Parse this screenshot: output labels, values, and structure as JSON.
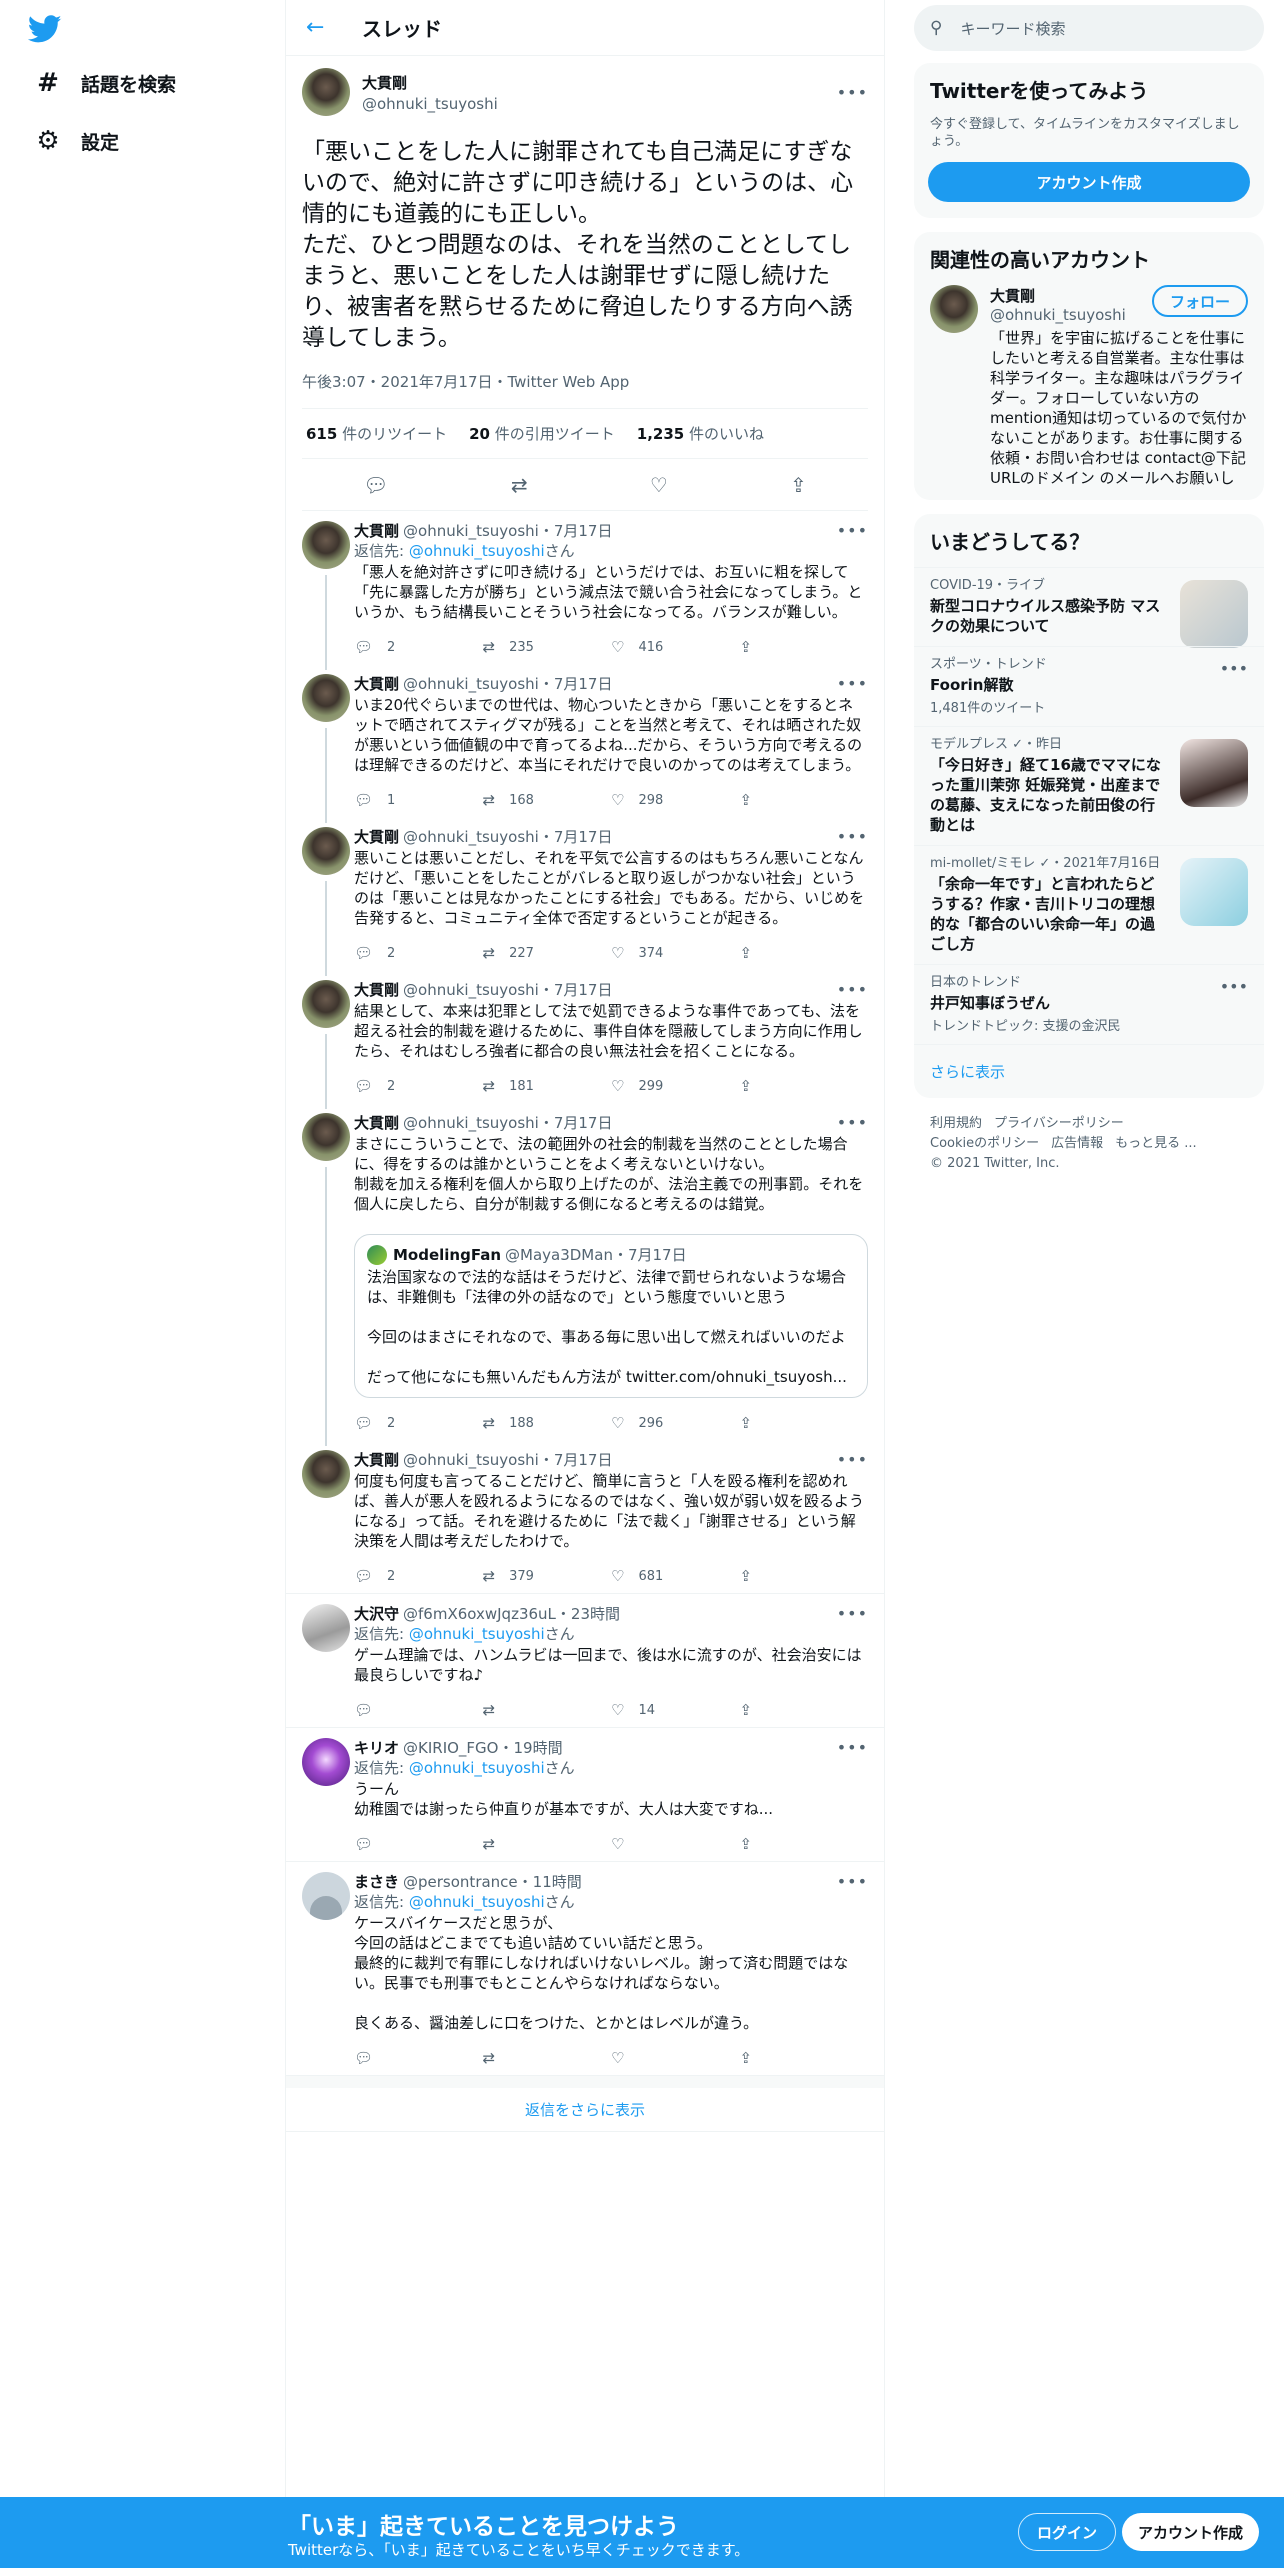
{
  "nav": {
    "explore": "話題を検索",
    "settings": "設定"
  },
  "header": {
    "title": "スレッド"
  },
  "focus": {
    "name": "大貫剛",
    "handle": "@ohnuki_tsuyoshi",
    "text": "「悪いことをした人に謝罪されても自己満足にすぎないので、絶対に許さずに叩き続ける」というのは、心情的にも道義的にも正しい。\nただ、ひとつ問題なのは、それを当然のこととしてしまうと、悪いことをした人は謝罪せずに隠し続けたり、被害者を黙らせるために脅迫したりする方向へ誘導してしまう。",
    "meta": "午後3:07・2021年7月17日・Twitter Web App",
    "retweets_num": "615",
    "retweets_label": "件のリツイート",
    "quotes_num": "20",
    "quotes_label": "件の引用ツイート",
    "likes_num": "1,235",
    "likes_label": "件のいいね"
  },
  "replies": [
    {
      "name": "大貫剛",
      "handle": "@ohnuki_tsuyoshi・7月17日",
      "to_prefix": "返信先: ",
      "to": "@ohnuki_tsuyoshi",
      "to_suffix": "さん",
      "text": "「悪人を絶対許さずに叩き続ける」というだけでは、お互いに粗を探して「先に暴露した方が勝ち」という減点法で競い合う社会になってしまう。というか、もう結構長いことそういう社会になってる。バランスが難しい。",
      "replies": "2",
      "retweets": "235",
      "likes": "416"
    },
    {
      "name": "大貫剛",
      "handle": "@ohnuki_tsuyoshi・7月17日",
      "text": "いま20代ぐらいまでの世代は、物心ついたときから「悪いことをするとネットで晒されてスティグマが残る」ことを当然と考えて、それは晒された奴が悪いという価値観の中で育ってるよね...だから、そういう方向で考えるのは理解できるのだけど、本当にそれだけで良いのかってのは考えてしまう。",
      "replies": "1",
      "retweets": "168",
      "likes": "298"
    },
    {
      "name": "大貫剛",
      "handle": "@ohnuki_tsuyoshi・7月17日",
      "text": "悪いことは悪いことだし、それを平気で公言するのはもちろん悪いことなんだけど、「悪いことをしたことがバレると取り返しがつかない社会」というのは「悪いことは見なかったことにする社会」でもある。だから、いじめを告発すると、コミュニティ全体で否定するということが起きる。",
      "replies": "2",
      "retweets": "227",
      "likes": "374"
    },
    {
      "name": "大貫剛",
      "handle": "@ohnuki_tsuyoshi・7月17日",
      "text": "結果として、本来は犯罪として法で処罰できるような事件であっても、法を超える社会的制裁を避けるために、事件自体を隠蔽してしまう方向に作用したら、それはむしろ強者に都合の良い無法社会を招くことになる。",
      "replies": "2",
      "retweets": "181",
      "likes": "299"
    },
    {
      "name": "大貫剛",
      "handle": "@ohnuki_tsuyoshi・7月17日",
      "text": "まさにこういうことで、法の範囲外の社会的制裁を当然のこととした場合に、得をするのは誰かということをよく考えないといけない。\n制裁を加える権利を個人から取り上げたのが、法治主義での刑事罰。それを個人に戻したら、自分が制裁する側になると考えるのは錯覚。",
      "quote_name": "ModelingFan",
      "quote_handle": "@Maya3DMan・7月17日",
      "quote_text": "法治国家なので法的な話はそうだけど、法律で罰せられないような場合は、非難側も「法律の外の話なので」という態度でいいと思う\n\n今回のはまさにそれなので、事ある毎に思い出して燃えればいいのだよ\n\nだって他になにも無いんだもん方法が twitter.com/ohnuki_tsuyosh...",
      "replies": "2",
      "retweets": "188",
      "likes": "296"
    },
    {
      "name": "大貫剛",
      "handle": "@ohnuki_tsuyoshi・7月17日",
      "text": "何度も何度も言ってることだけど、簡単に言うと「人を殴る権利を認めれば、善人が悪人を殴れるようになるのではなく、強い奴が弱い奴を殴るようになる」って話。それを避けるために「法で裁く」「謝罪させる」という解決策を人間は考えだしたわけで。",
      "replies": "2",
      "retweets": "379",
      "likes": "681"
    },
    {
      "name": "大沢守",
      "handle": "@f6mX6oxwJqz36uL・23時間",
      "to_prefix": "返信先: ",
      "to": "@ohnuki_tsuyoshi",
      "to_suffix": "さん",
      "text": "ゲーム理論では、ハンムラビは一回まで、後は水に流すのが、社会治安には最良らしいですね♪",
      "replies": "",
      "retweets": "",
      "likes": "14"
    },
    {
      "name": "キリオ",
      "handle": "@KIRIO_FGO・19時間",
      "to_prefix": "返信先: ",
      "to": "@ohnuki_tsuyoshi",
      "to_suffix": "さん",
      "text": "うーん\n幼稚園では謝ったら仲直りが基本ですが、大人は大変ですね...",
      "replies": "",
      "retweets": "",
      "likes": ""
    },
    {
      "name": "まさき",
      "handle": "@persontrance・11時間",
      "to_prefix": "返信先: ",
      "to": "@ohnuki_tsuyoshi",
      "to_suffix": "さん",
      "text": "ケースバイケースだと思うが、\n今回の話はどこまでても追い詰めていい話だと思う。\n最終的に裁判で有罪にしなければいけないレベル。謝って済む問題ではない。民事でも刑事でもとことんやらなければならない。\n\n良くある、醤油差しに口をつけた、とかとはレベルが違う。",
      "replies": "",
      "retweets": "",
      "likes": ""
    }
  ],
  "show_more_replies": "返信をさらに表示",
  "sidebar": {
    "search_placeholder": "キーワード検索",
    "promo_title": "Twitterを使ってみよう",
    "promo_text": "今すぐ登録して、タイムラインをカスタマイズしましょう。",
    "signup": "アカウント作成",
    "relevant_title": "関連性の高いアカウント",
    "rel_name": "大貫剛",
    "rel_handle": "@ohnuki_tsuyoshi",
    "follow": "フォロー",
    "rel_bio": "「世界」を宇宙に拡げることを仕事にしたいと考える自営業者。主な仕事は科学ライター。主な趣味はパラグライダー。フォローしていない方のmention通知は切っているので気付かないことがあります。お仕事に関する依頼・お問い合わせは contact@下記URLのドメイン のメールへお願いします。アイコンは自撮り（FaceApp",
    "trends_title": "いまどうしてる？",
    "trends": [
      {
        "ctx": "COVID-19・ライブ",
        "title": "新型コロナウイルス感染予防 マスクの効果について",
        "count": ""
      },
      {
        "ctx": "スポーツ・トレンド",
        "title": "Foorin解散",
        "count": "1,481件のツイート"
      },
      {
        "ctx": "モデルプレス ✓・昨日",
        "title": "「今日好き」経て16歳でママになった重川茉弥 妊娠発覚・出産までの葛藤、支えになった前田俊の行動とは",
        "count": ""
      },
      {
        "ctx": "mi-mollet/ミモレ ✓・2021年7月16日",
        "title": "「余命一年です」と言われたらどうする？作家・吉川トリコの理想的な「都合のいい余命一年」の過ごし方",
        "count": ""
      },
      {
        "ctx": "日本のトレンド",
        "title": "井戸知事ぼうぜん",
        "count": "トレンドトピック: 支援の金沢民"
      }
    ],
    "show_more": "さらに表示",
    "footer": [
      "利用規約",
      "プライバシーポリシー",
      "Cookieのポリシー",
      "広告情報",
      "もっと見る ...",
      "© 2021 Twitter, Inc."
    ]
  },
  "bottom": {
    "title": "「いま」起きていることを見つけよう",
    "sub": "Twitterなら、「いま」起きていることをいち早くチェックできます。",
    "login": "ログイン",
    "signup": "アカウント作成"
  }
}
